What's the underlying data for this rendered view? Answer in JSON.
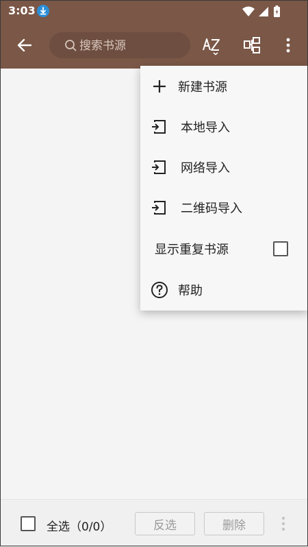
{
  "status_bar": {
    "time": "3:03"
  },
  "toolbar": {
    "search_placeholder": "搜索书源"
  },
  "menu": {
    "items": [
      {
        "label": "新建书源",
        "icon": "plus-icon"
      },
      {
        "label": "本地导入",
        "icon": "import-icon"
      },
      {
        "label": "网络导入",
        "icon": "import-icon"
      },
      {
        "label": "二维码导入",
        "icon": "import-icon"
      },
      {
        "label": "显示重复书源",
        "icon": "checkbox",
        "checked": false
      },
      {
        "label": "帮助",
        "icon": "help-icon"
      }
    ]
  },
  "bottom_bar": {
    "select_all_label": "全选（0/0）",
    "invert_label": "反选",
    "delete_label": "删除"
  },
  "colors": {
    "toolbar": "#7a5747",
    "search_bg": "#6e4e40",
    "menu_bg": "#f7f7f7",
    "content_bg": "#f4f4f4"
  }
}
